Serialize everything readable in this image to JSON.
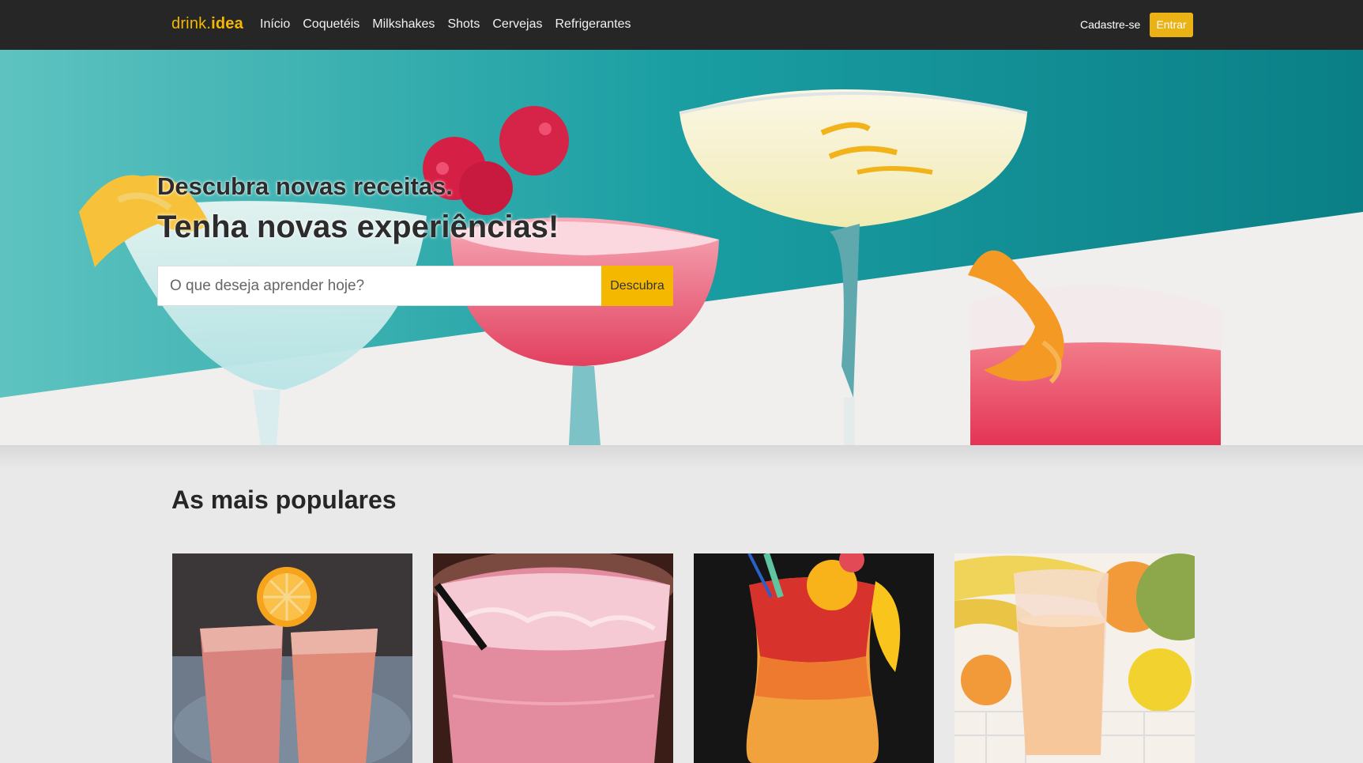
{
  "navbar": {
    "brand_prefix": "drink.",
    "brand_suffix": "idea",
    "links": [
      "Início",
      "Coquetéis",
      "Milkshakes",
      "Shots",
      "Cervejas",
      "Refrigerantes"
    ],
    "signup_label": "Cadastre-se",
    "login_label": "Entrar"
  },
  "hero": {
    "subtitle": "Descubra novas receitas.",
    "title": "Tenha novas experiências!",
    "search_placeholder": "O que deseja aprender hoje?",
    "search_button": "Descubra"
  },
  "popular": {
    "title": "As mais populares"
  },
  "colors": {
    "brand": "#f5b800",
    "navbar_bg": "#262626",
    "hero_teal": "#1e9aa0",
    "page_bg": "#e9e9e9"
  }
}
